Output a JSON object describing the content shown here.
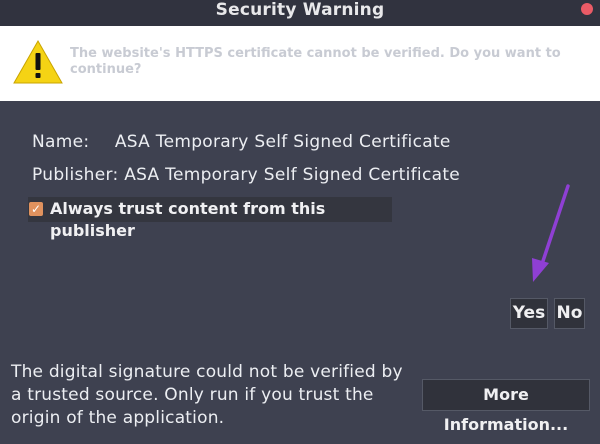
{
  "window": {
    "title": "Security Warning",
    "close_icon": "close-icon"
  },
  "banner": {
    "icon": "warning-icon",
    "message": "The website's HTTPS certificate cannot be verified. Do you want to continue?"
  },
  "certificate": {
    "name_label": "Name:",
    "name_value": "ASA Temporary Self Signed Certificate",
    "publisher_label": "Publisher:",
    "publisher_value": "ASA Temporary Self Signed Certificate"
  },
  "trust": {
    "label": "Always trust content from this publisher",
    "checked": true
  },
  "buttons": {
    "yes": "Yes",
    "no": "No",
    "more_info": "More Information..."
  },
  "footer": {
    "message": "The digital signature could not be verified by a trusted source. Only run if you trust the origin of the application."
  },
  "colors": {
    "background": "#3e4150",
    "titlebar": "#31333f",
    "close_button": "#ea5b66",
    "checkbox": "#e0925e",
    "annotation_arrow": "#8f3fd4"
  }
}
